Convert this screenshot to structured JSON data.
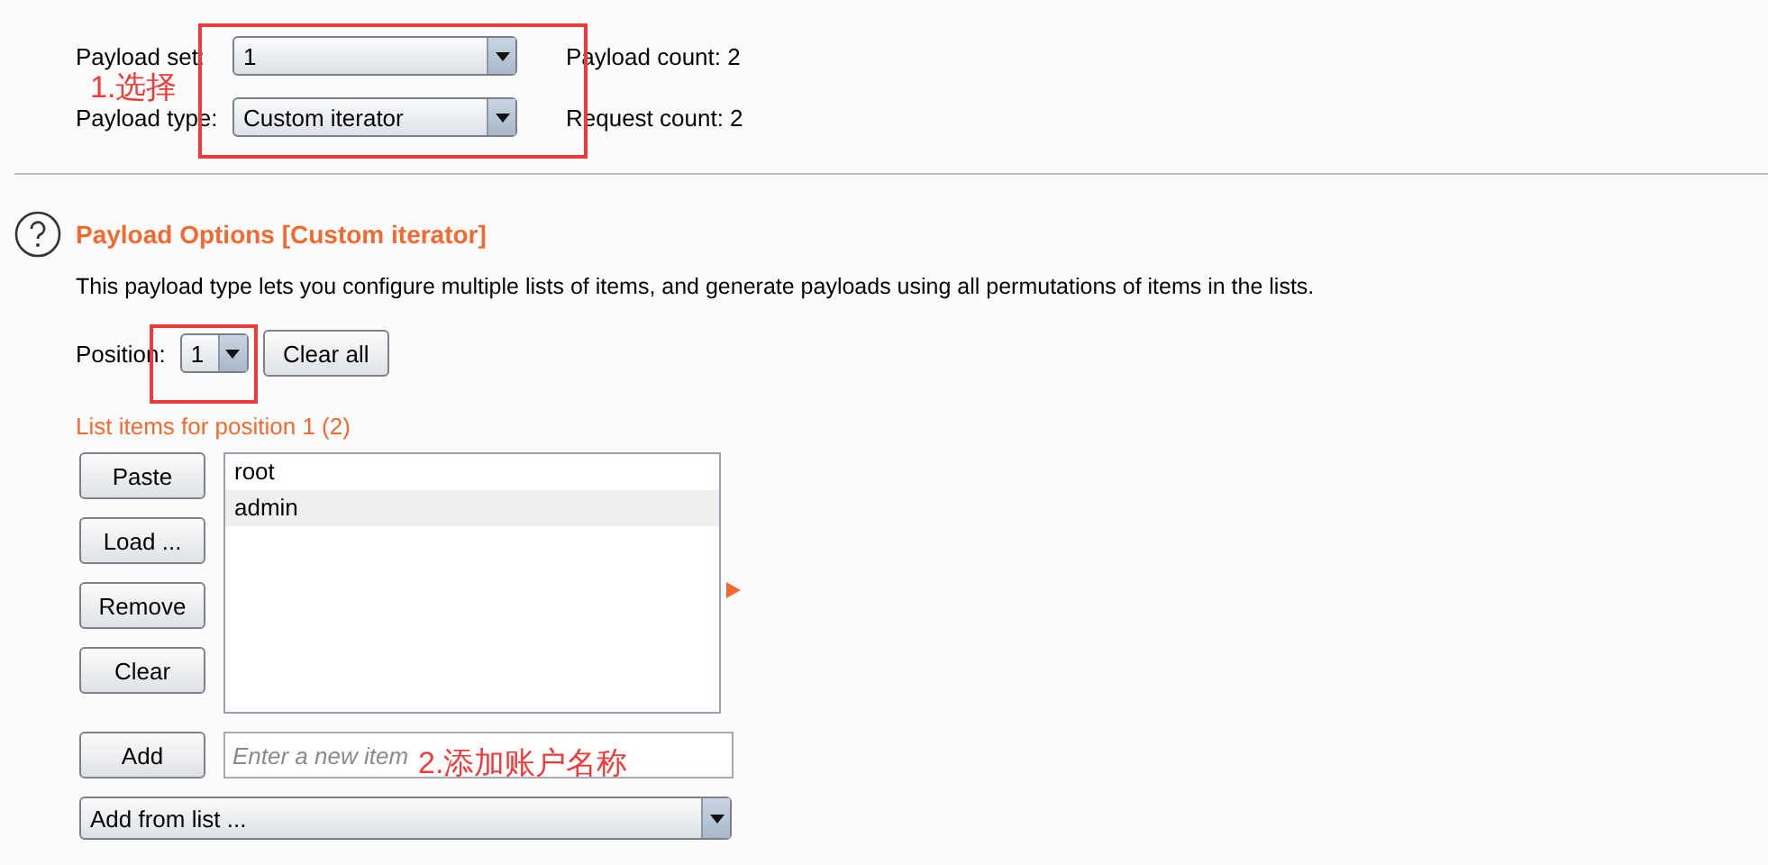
{
  "payload_settings": {
    "payload_set": {
      "label": "Payload set:",
      "value": "1"
    },
    "payload_type": {
      "label": "Payload type:",
      "value": "Custom iterator"
    },
    "payload_count": "Payload count: 2",
    "request_count": "Request count: 2"
  },
  "payload_options": {
    "title": "Payload Options [Custom iterator]",
    "description": "This payload type lets you configure multiple lists of items, and generate payloads using all permutations of items in the lists.",
    "position": {
      "label": "Position:",
      "value": "1"
    },
    "clear_all": "Clear all",
    "list_title": "List items for position 1 (2)",
    "buttons": [
      "Paste",
      "Load ...",
      "Remove",
      "Clear"
    ],
    "items": [
      {
        "text": "root",
        "selected": false
      },
      {
        "text": "admin",
        "selected": true
      }
    ],
    "add_button": "Add",
    "new_item": {
      "placeholder": "Enter a new item"
    },
    "add_from_list": "Add from list ..."
  },
  "annotations": [
    {
      "text": "1.选择"
    },
    {
      "text": "2.添加账户名称"
    }
  ]
}
